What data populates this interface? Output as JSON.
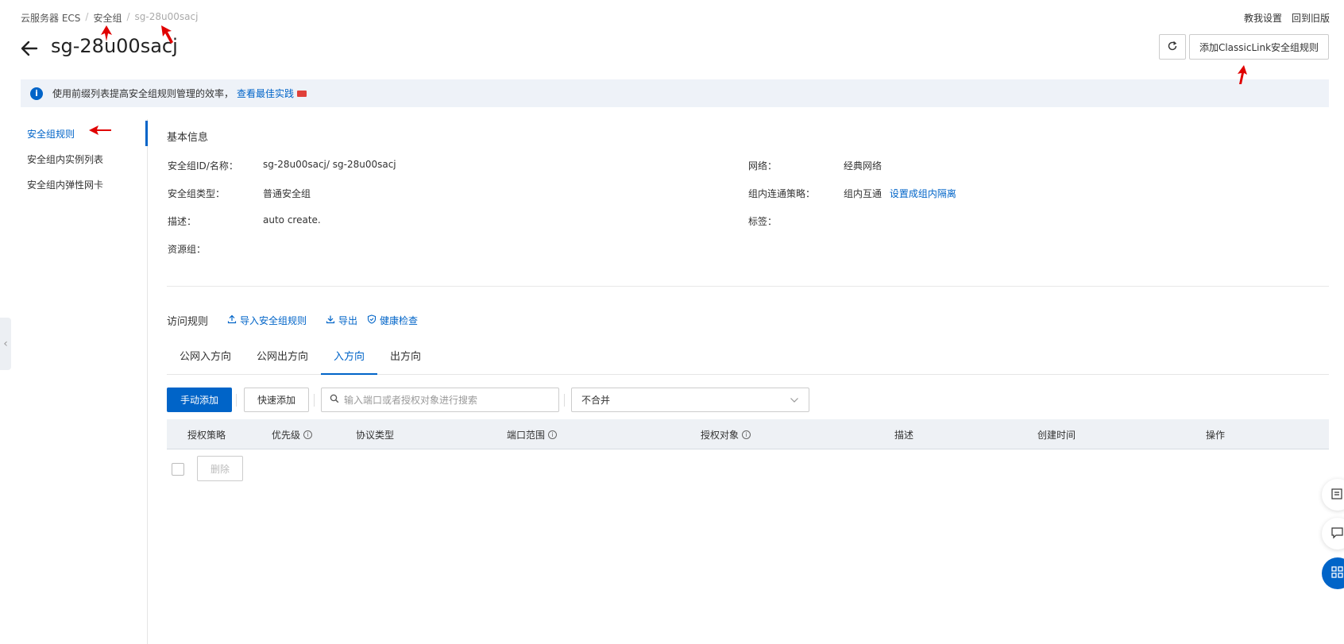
{
  "breadcrumb": {
    "items": [
      "云服务器 ECS",
      "安全组",
      "sg-28u00sacj"
    ]
  },
  "top_links": {
    "guide": "教我设置",
    "old_version": "回到旧版"
  },
  "header": {
    "title": "sg-28u00sacj",
    "classic_link_button": "添加ClassicLink安全组规则"
  },
  "info_bar": {
    "text": "使用前缀列表提高安全组规则管理的效率，",
    "link": "查看最佳实践"
  },
  "sidebar": {
    "items": [
      {
        "label": "安全组规则",
        "active": true
      },
      {
        "label": "安全组内实例列表",
        "active": false
      },
      {
        "label": "安全组内弹性网卡",
        "active": false
      }
    ]
  },
  "basic_info": {
    "title": "基本信息",
    "fields": {
      "id_name_label": "安全组ID/名称：",
      "id_name_value": "sg-28u00sacj/ sg-28u00sacj",
      "type_label": "安全组类型：",
      "type_value": "普通安全组",
      "desc_label": "描述：",
      "desc_value": "auto create.",
      "rg_label": "资源组：",
      "network_label": "网络：",
      "network_value": "经典网络",
      "policy_label": "组内连通策略：",
      "policy_value": "组内互通",
      "policy_link": "设置成组内隔离",
      "tags_label": "标签："
    }
  },
  "access_rules": {
    "title": "访问规则",
    "import": "导入安全组规则",
    "export": "导出",
    "health": "健康检查"
  },
  "tabs": [
    {
      "label": "公网入方向",
      "active": false
    },
    {
      "label": "公网出方向",
      "active": false
    },
    {
      "label": "入方向",
      "active": true
    },
    {
      "label": "出方向",
      "active": false
    }
  ],
  "toolbar": {
    "manual_add": "手动添加",
    "quick_add": "快速添加",
    "search_placeholder": "输入端口或者授权对象进行搜索",
    "merge_select": "不合并"
  },
  "table": {
    "columns": [
      "授权策略",
      "优先级",
      "协议类型",
      "端口范围",
      "授权对象",
      "描述",
      "创建时间",
      "操作"
    ]
  },
  "bulk": {
    "delete": "删除"
  },
  "colors": {
    "accent": "#0064c8",
    "annotation": "#e00000"
  }
}
